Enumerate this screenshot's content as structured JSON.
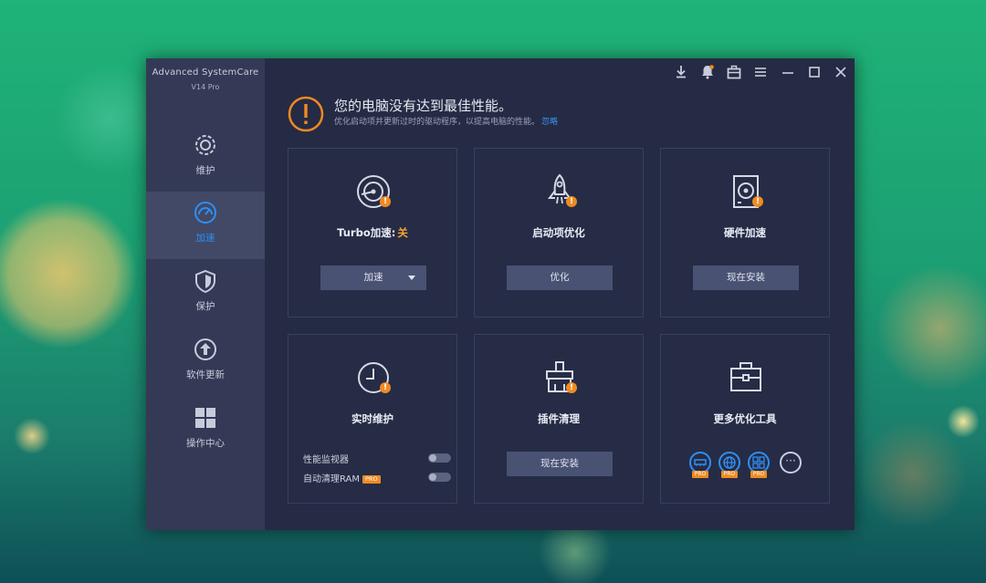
{
  "app": {
    "name": "Advanced SystemCare",
    "version": "V14 Pro"
  },
  "topbar": {
    "icons": [
      "download-icon",
      "notification-icon",
      "toolbox-icon",
      "menu-icon",
      "minimize-icon",
      "maximize-icon",
      "close-icon"
    ]
  },
  "sidebar": {
    "items": [
      {
        "label": "维护",
        "icon": "gear-icon",
        "active": false
      },
      {
        "label": "加速",
        "icon": "speedometer-icon",
        "active": true
      },
      {
        "label": "保护",
        "icon": "shield-icon",
        "active": false
      },
      {
        "label": "软件更新",
        "icon": "upload-icon",
        "active": false
      },
      {
        "label": "操作中心",
        "icon": "grid-icon",
        "active": false
      }
    ]
  },
  "alert": {
    "title": "您的电脑没有达到最佳性能。",
    "subtitle": "优化启动项并更新过时的驱动程序，以提高电脑的性能。",
    "link": "忽略"
  },
  "cards": [
    {
      "title": "Turbo加速:",
      "status": "关",
      "button": "加速",
      "icon": "disk-gauge-icon"
    },
    {
      "title": "启动项优化",
      "button": "优化",
      "icon": "rocket-icon"
    },
    {
      "title": "硬件加速",
      "button": "现在安装",
      "icon": "hard-drive-icon"
    },
    {
      "title": "实时维护",
      "icon": "clock-icon",
      "toggles": [
        {
          "label": "性能监视器",
          "pro": ""
        },
        {
          "label": "自动清理RAM",
          "pro": "PRO"
        }
      ]
    },
    {
      "title": "插件清理",
      "button": "现在安装",
      "icon": "brush-icon"
    },
    {
      "title": "更多优化工具",
      "icon": "toolbox-icon",
      "tools": [
        {
          "pro": "PRO",
          "icon": "ram-icon"
        },
        {
          "pro": "PRO",
          "icon": "internet-booster-icon"
        },
        {
          "pro": "PRO",
          "icon": "app-tools-icon"
        }
      ],
      "more": "···"
    }
  ],
  "colors": {
    "accent": "#2f8ff4",
    "warning": "#f08a22",
    "window_bg": "#252b44",
    "sidebar_bg": "#343a55"
  }
}
